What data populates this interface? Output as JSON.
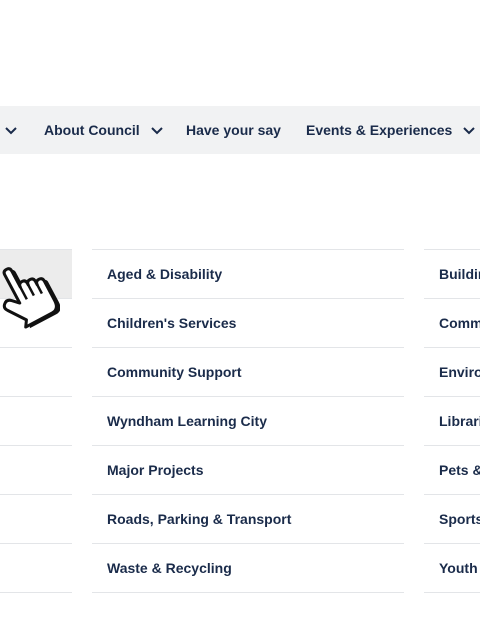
{
  "nav": {
    "items": [
      {
        "label": "About Council"
      },
      {
        "label": "Have your say"
      },
      {
        "label": "Events & Experiences"
      }
    ]
  },
  "menu": {
    "middle": [
      {
        "label": "Aged & Disability"
      },
      {
        "label": "Children's Services"
      },
      {
        "label": "Community Support"
      },
      {
        "label": "Wyndham Learning City"
      },
      {
        "label": "Major Projects"
      },
      {
        "label": "Roads, Parking & Transport"
      },
      {
        "label": "Waste & Recycling"
      }
    ],
    "right": [
      {
        "label": "Buildin"
      },
      {
        "label": "Comm"
      },
      {
        "label": "Enviro"
      },
      {
        "label": "Librari"
      },
      {
        "label": "Pets &"
      },
      {
        "label": "Sports"
      },
      {
        "label": "Youth"
      }
    ]
  },
  "icons": {
    "chevron": "chevron-down-icon",
    "cursor": "hand-pointer-icon"
  },
  "colors": {
    "nav_bg": "#f1f2f3",
    "text": "#1a2b4a",
    "divider": "#e3e5e8",
    "hover_bg": "#ececec"
  }
}
